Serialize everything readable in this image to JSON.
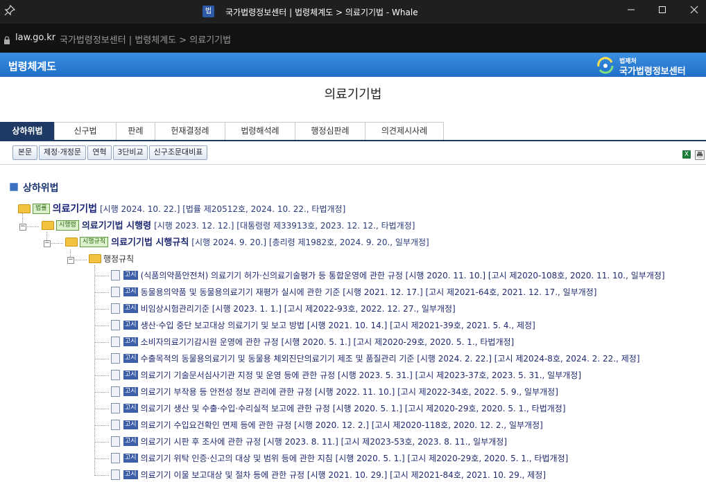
{
  "window": {
    "title": "국가법령정보센터 | 법령체계도 > 의료기기법 - Whale",
    "app_icon": "법"
  },
  "address_bar": {
    "domain": "law.go.kr",
    "page_title": "국가법령정보센터 | 법령체계도 > 의료기기법"
  },
  "banner": {
    "title": "법령체계도",
    "logo_small": "법제처",
    "logo_big": "국가법령정보센터"
  },
  "doc_title": "의료기기법",
  "tabs": [
    "상하위법",
    "신구법",
    "판례",
    "헌재결정례",
    "법령해석례",
    "행정심판례",
    "의견제시사례"
  ],
  "buttons": [
    "본문",
    "제정·개정문",
    "연혁",
    "3단비교",
    "신구조문대비표"
  ],
  "section_title": "상하위법",
  "tree": {
    "law": {
      "badge": "법률",
      "name": "의료기기법",
      "meta": "[시행 2024. 10. 22.] [법률 제20512호, 2024. 10. 22., 타법개정]"
    },
    "decree": {
      "badge": "시행령",
      "name": "의료기기법 시행령",
      "meta": "[시행 2023. 12. 12.] [대통령령 제33913호, 2023. 12. 12., 타법개정]"
    },
    "rule": {
      "badge": "시행규칙",
      "name": "의료기기법 시행규칙",
      "meta": "[시행 2024. 9. 20.] [총리령 제1982호, 2024. 9. 20., 일부개정]"
    },
    "admin_folder": "행정규칙",
    "items": [
      {
        "badge": "고시",
        "text": "(식품의약품안전처) 의료기기 허가·신의료기술평가 등 통합운영에 관한 규정 [시행 2020. 11. 10.] [고시 제2020-108호, 2020. 11. 10., 일부개정]"
      },
      {
        "badge": "고시",
        "text": "동물용의약품 및 동물용의료기기 재평가 실시에 관한 기준 [시행 2021. 12. 17.] [고시 제2021-64호, 2021. 12. 17., 일부개정]"
      },
      {
        "badge": "고시",
        "text": "비임상시험관리기준 [시행 2023. 1. 1.] [고시 제2022-93호, 2022. 12. 27., 일부개정]"
      },
      {
        "badge": "고시",
        "text": "생산·수입 중단 보고대상 의료기기 및 보고 방법 [시행 2021. 10. 14.] [고시 제2021-39호, 2021. 5. 4., 제정]"
      },
      {
        "badge": "고시",
        "text": "소비자의료기기감시원 운영에 관한 규정 [시행 2020. 5. 1.] [고시 제2020-29호, 2020. 5. 1., 타법개정]"
      },
      {
        "badge": "고시",
        "text": "수출목적의 동물용의료기기 및 동물용 체외진단의료기기 제조 및 품질관리 기준 [시행 2024. 2. 22.] [고시 제2024-8호, 2024. 2. 22., 제정]"
      },
      {
        "badge": "고시",
        "text": "의료기기 기술문서심사기관 지정 및 운영 등에 관한 규정 [시행 2023. 5. 31.] [고시 제2023-37호, 2023. 5. 31., 일부개정]"
      },
      {
        "badge": "고시",
        "text": "의료기기 부작용 등 안전성 정보 관리에 관한 규정 [시행 2022. 11. 10.] [고시 제2022-34호, 2022. 5. 9., 일부개정]"
      },
      {
        "badge": "고시",
        "text": "의료기기 생산 및 수출·수입·수리실적 보고에 관한 규정 [시행 2020. 5. 1.] [고시 제2020-29호, 2020. 5. 1., 타법개정]"
      },
      {
        "badge": "고시",
        "text": "의료기기 수입요건확인 면제 등에 관한 규정 [시행 2020. 12. 2.] [고시 제2020-118호, 2020. 12. 2., 일부개정]"
      },
      {
        "badge": "고시",
        "text": "의료기기 시판 후 조사에 관한 규정 [시행 2023. 8. 11.] [고시 제2023-53호, 2023. 8. 11., 일부개정]"
      },
      {
        "badge": "고시",
        "text": "의료기기 위탁 인증·신고의 대상 및 범위 등에 관한 지침 [시행 2020. 5. 1.] [고시 제2020-29호, 2020. 5. 1., 타법개정]"
      },
      {
        "badge": "고시",
        "text": "의료기기 이물 보고대상 및 절차 등에 관한 규정 [시행 2021. 10. 29.] [고시 제2021-84호, 2021. 10. 29., 제정]"
      }
    ]
  }
}
